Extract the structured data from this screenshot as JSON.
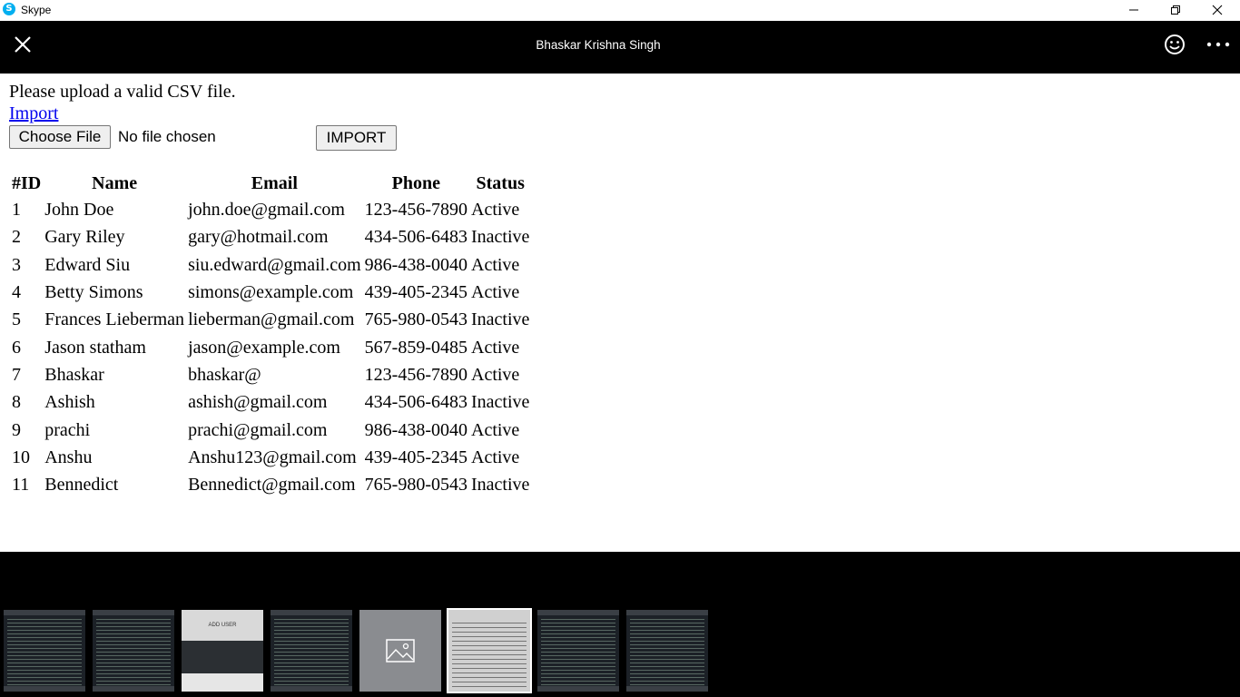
{
  "window": {
    "app_title": "Skype",
    "logo_letter": "S"
  },
  "viewer": {
    "contact_name": "Bhaskar Krishna Singh"
  },
  "page": {
    "message": "Please upload a valid CSV file.",
    "import_link": "Import",
    "choose_file_label": "Choose File",
    "no_file_text": "No file chosen",
    "import_button": "IMPORT"
  },
  "table": {
    "headers": [
      "#ID",
      "Name",
      "Email",
      "Phone",
      "Status"
    ],
    "rows": [
      [
        "1",
        "John Doe",
        "john.doe@gmail.com",
        "123-456-7890",
        "Active"
      ],
      [
        "2",
        "Gary Riley",
        "gary@hotmail.com",
        "434-506-6483",
        "Inactive"
      ],
      [
        "3",
        "Edward Siu",
        "siu.edward@gmail.com",
        "986-438-0040",
        "Active"
      ],
      [
        "4",
        "Betty Simons",
        "simons@example.com",
        "439-405-2345",
        "Active"
      ],
      [
        "5",
        "Frances Lieberman",
        "lieberman@gmail.com",
        "765-980-0543",
        "Inactive"
      ],
      [
        "6",
        "Jason statham",
        "jason@example.com",
        "567-859-0485",
        "Active"
      ],
      [
        "7",
        "Bhaskar",
        "bhaskar@",
        "123-456-7890",
        "Active"
      ],
      [
        "8",
        "Ashish",
        "ashish@gmail.com",
        "434-506-6483",
        "Inactive"
      ],
      [
        "9",
        "prachi",
        "prachi@gmail.com",
        "986-438-0040",
        "Active"
      ],
      [
        "10",
        "Anshu",
        "Anshu123@gmail.com",
        "439-405-2345",
        "Active"
      ],
      [
        "11",
        "Bennedict",
        "Bennedict@gmail.com",
        "765-980-0543",
        "Inactive"
      ]
    ]
  },
  "thumbnails": {
    "add_user_title": "ADD USER",
    "items": [
      "code-screenshot",
      "code-screenshot",
      "add-user-form",
      "code-screenshot",
      "image-placeholder",
      "user-table (selected)",
      "code-screenshot",
      "code-screenshot"
    ]
  },
  "icons": {
    "close": "close-icon",
    "emoji": "emoji-icon",
    "more": "more-options-icon",
    "minimize": "minimize-icon",
    "restore": "restore-icon",
    "window_close": "window-close-icon",
    "image_placeholder": "image-icon"
  },
  "colors": {
    "skype_blue": "#00aff0",
    "link": "#0000ee",
    "header_bg": "#000000"
  }
}
